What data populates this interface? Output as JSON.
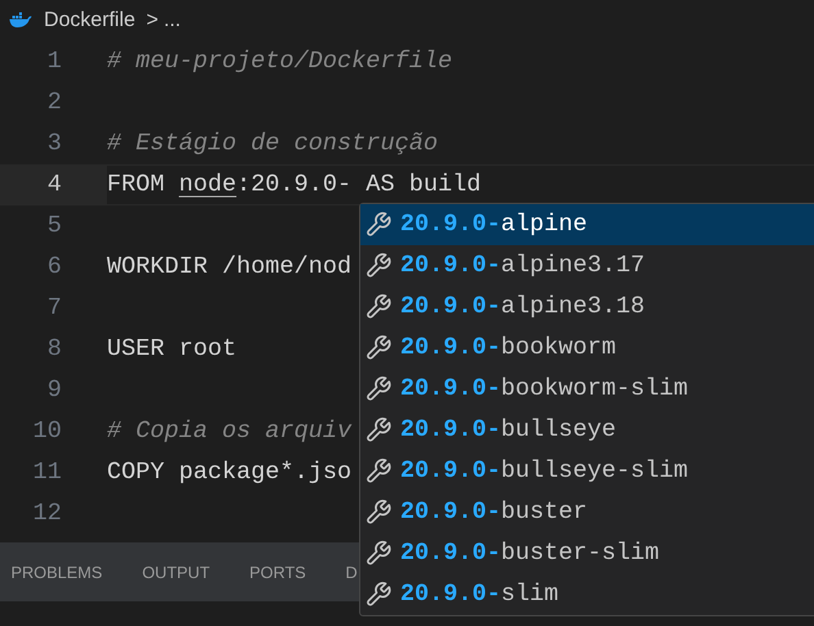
{
  "breadcrumb": {
    "file": "Dockerfile",
    "separator": ">",
    "more": "..."
  },
  "editor": {
    "lines": [
      {
        "number": "1",
        "kind": "comment",
        "current": false,
        "segments": [
          {
            "text": "# meu-projeto/Dockerfile",
            "underlined": false
          }
        ]
      },
      {
        "number": "2",
        "current": false
      },
      {
        "number": "3",
        "kind": "comment",
        "current": false,
        "segments": [
          {
            "text": "# Estágio de construção",
            "underlined": false
          }
        ]
      },
      {
        "number": "4",
        "kind": "code",
        "current": true,
        "segments": [
          {
            "text": "FROM ",
            "underlined": false
          },
          {
            "text": "node",
            "underlined": true
          },
          {
            "text": ":20.9.0- AS build",
            "underlined": false
          }
        ]
      },
      {
        "number": "5",
        "current": false
      },
      {
        "number": "6",
        "kind": "code",
        "current": false,
        "segments": [
          {
            "text": "WORKDIR /home/nod",
            "underlined": false
          }
        ]
      },
      {
        "number": "7",
        "current": false
      },
      {
        "number": "8",
        "kind": "code",
        "current": false,
        "segments": [
          {
            "text": "USER root",
            "underlined": false
          }
        ]
      },
      {
        "number": "9",
        "current": false
      },
      {
        "number": "10",
        "kind": "comment",
        "current": false,
        "segments": [
          {
            "text": "# Copia os arquiv",
            "underlined": false
          }
        ]
      },
      {
        "number": "11",
        "kind": "code",
        "current": false,
        "segments": [
          {
            "text": "COPY package*.jso",
            "underlined": false
          }
        ]
      },
      {
        "number": "12",
        "current": false
      }
    ]
  },
  "suggestions": [
    {
      "prefix": "20.9.0-",
      "suffix": "alpine",
      "selected": true
    },
    {
      "prefix": "20.9.0-",
      "suffix": "alpine3.17",
      "selected": false
    },
    {
      "prefix": "20.9.0-",
      "suffix": "alpine3.18",
      "selected": false
    },
    {
      "prefix": "20.9.0-",
      "suffix": "bookworm",
      "selected": false
    },
    {
      "prefix": "20.9.0-",
      "suffix": "bookworm-slim",
      "selected": false
    },
    {
      "prefix": "20.9.0-",
      "suffix": "bullseye",
      "selected": false
    },
    {
      "prefix": "20.9.0-",
      "suffix": "bullseye-slim",
      "selected": false
    },
    {
      "prefix": "20.9.0-",
      "suffix": "buster",
      "selected": false
    },
    {
      "prefix": "20.9.0-",
      "suffix": "buster-slim",
      "selected": false
    },
    {
      "prefix": "20.9.0-",
      "suffix": "slim",
      "selected": false
    }
  ],
  "panel_tabs": [
    "PROBLEMS",
    "OUTPUT",
    "PORTS",
    "D"
  ]
}
